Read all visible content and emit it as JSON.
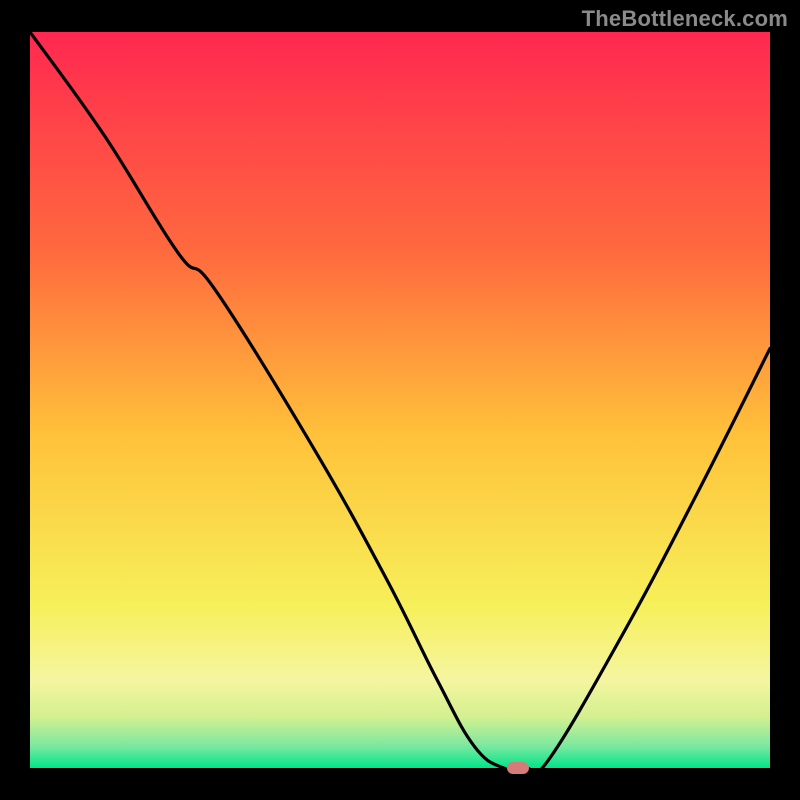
{
  "watermark": "TheBottleneck.com",
  "colors": {
    "bg": "#000000",
    "grad_top": "#ff2850",
    "grad_upper_mid": "#ff8c3a",
    "grad_mid": "#ffd33a",
    "grad_lower": "#f5f58a",
    "grad_band": "#cff0a0",
    "grad_bottom": "#00e589",
    "curve": "#000000",
    "marker": "#d77a7a"
  },
  "chart_data": {
    "type": "line",
    "title": "",
    "xlabel": "",
    "ylabel": "",
    "xlim": [
      0,
      100
    ],
    "ylim": [
      0,
      100
    ],
    "x": [
      0,
      10,
      20,
      25,
      38,
      48,
      55,
      60,
      64,
      67,
      70,
      80,
      90,
      100
    ],
    "values": [
      100,
      86,
      70,
      65,
      44,
      26,
      12,
      3,
      0,
      0,
      1,
      18,
      37,
      57
    ],
    "marker": {
      "x": 66,
      "y": 0
    },
    "gradient_stops": [
      {
        "offset": 0.0,
        "color": "#ff2850"
      },
      {
        "offset": 0.3,
        "color": "#ff6a3e"
      },
      {
        "offset": 0.55,
        "color": "#ffc23a"
      },
      {
        "offset": 0.78,
        "color": "#f6f05a"
      },
      {
        "offset": 0.88,
        "color": "#f5f5a0"
      },
      {
        "offset": 0.93,
        "color": "#d4f090"
      },
      {
        "offset": 0.97,
        "color": "#7ce8a0"
      },
      {
        "offset": 1.0,
        "color": "#00e589"
      }
    ]
  }
}
